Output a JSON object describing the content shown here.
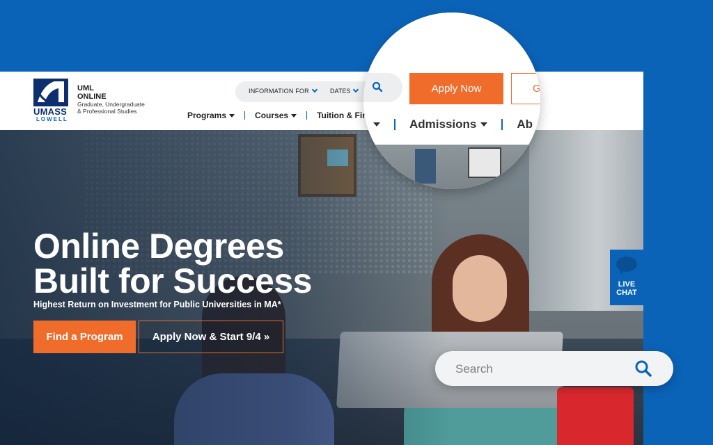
{
  "brand": {
    "logo_top": "UMASS",
    "logo_bottom": "LOWELL",
    "line1": "UML",
    "line2": "ONLINE",
    "line3": "Graduate, Undergraduate",
    "line4": "& Professional Studies"
  },
  "utility": {
    "info_label": "INFORMATION FOR",
    "dates_label": "DATES"
  },
  "nav": {
    "programs": "Programs",
    "courses": "Courses",
    "tuition": "Tuition & Fina"
  },
  "hero": {
    "title_line1": "Online Degrees",
    "title_line2": "Built for Success",
    "subtitle": "Highest Return on Investment for Public Universities in MA*",
    "find_button": "Find a Program",
    "apply_button": "Apply Now & Start 9/4 »"
  },
  "live_chat": {
    "line1": "LIVE",
    "line2": "CHAT"
  },
  "search": {
    "placeholder": "Search"
  },
  "magnifier": {
    "apply_button": "Apply Now",
    "ghost_button_letter": "G",
    "admissions": "Admissions",
    "next_nav_partial": "Ab"
  },
  "colors": {
    "brand_blue": "#0b63b8",
    "navy": "#0d2f6e",
    "accent_orange": "#ef6c2b"
  }
}
